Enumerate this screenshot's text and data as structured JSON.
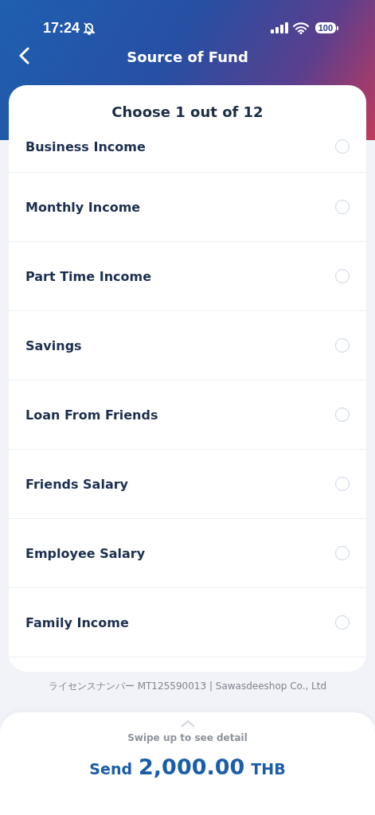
{
  "status_bar": {
    "time": "17:24",
    "battery": "100"
  },
  "header": {
    "title": "Source of Fund"
  },
  "list": {
    "heading": "Choose 1 out of 12",
    "options": [
      {
        "label": "Business Income",
        "selected": false
      },
      {
        "label": "Monthly Income",
        "selected": false
      },
      {
        "label": "Part Time Income",
        "selected": false
      },
      {
        "label": "Savings",
        "selected": false
      },
      {
        "label": "Loan From Friends",
        "selected": false
      },
      {
        "label": "Friends Salary",
        "selected": false
      },
      {
        "label": "Employee Salary",
        "selected": false
      },
      {
        "label": "Family Income",
        "selected": false
      }
    ]
  },
  "footer_note": "ライセンスナンバー MT125590013 | Sawasdeeshop Co., Ltd",
  "bottom_sheet": {
    "hint": "Swipe up to see detail",
    "send_label": "Send",
    "amount": "2,000.00",
    "currency": "THB"
  }
}
